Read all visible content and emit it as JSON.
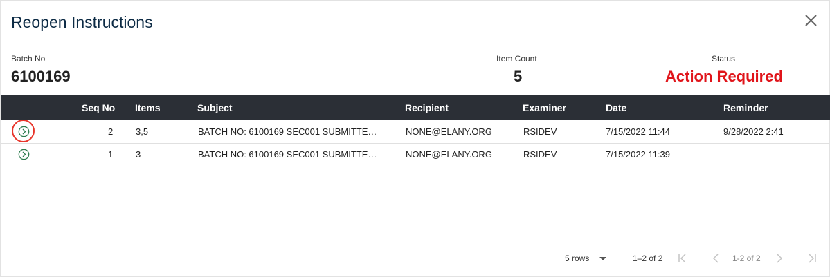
{
  "dialog": {
    "title": "Reopen Instructions"
  },
  "summary": {
    "batch_label": "Batch No",
    "batch_value": "6100169",
    "count_label": "Item Count",
    "count_value": "5",
    "status_label": "Status",
    "status_value": "Action Required",
    "status_color": "#e0141a"
  },
  "table": {
    "columns": [
      "Seq No",
      "Items",
      "Subject",
      "Recipient",
      "Examiner",
      "Date",
      "Reminder"
    ],
    "rows": [
      {
        "seq": "2",
        "items": "3,5",
        "subject": "BATCH NO: 6100169 SEC001 SUBMITTE…",
        "recipient": "NONE@ELANY.ORG",
        "examiner": "RSIDEV",
        "date": "7/15/2022 11:44",
        "reminder": "9/28/2022 2:41"
      },
      {
        "seq": "1",
        "items": "3",
        "subject": "BATCH NO: 6100169 SEC001 SUBMITTE…",
        "recipient": "NONE@ELANY.ORG",
        "examiner": "RSIDEV",
        "date": "7/15/2022 11:39",
        "reminder": ""
      }
    ]
  },
  "pagination": {
    "rows_per_page": "5 rows",
    "range_text": "1–2 of 2",
    "page_text": "1-2 of 2"
  },
  "icons": {
    "close": "close-icon",
    "expand": "chevron-right-circle-icon",
    "first": "first-page-icon",
    "prev": "chevron-left-icon",
    "next": "chevron-right-icon",
    "last": "last-page-icon",
    "dropdown": "dropdown-arrow-icon"
  },
  "colors": {
    "header_bg": "#2b2f36",
    "expand_icon": "#2e7d4f",
    "focus_ring": "#e8352a"
  }
}
